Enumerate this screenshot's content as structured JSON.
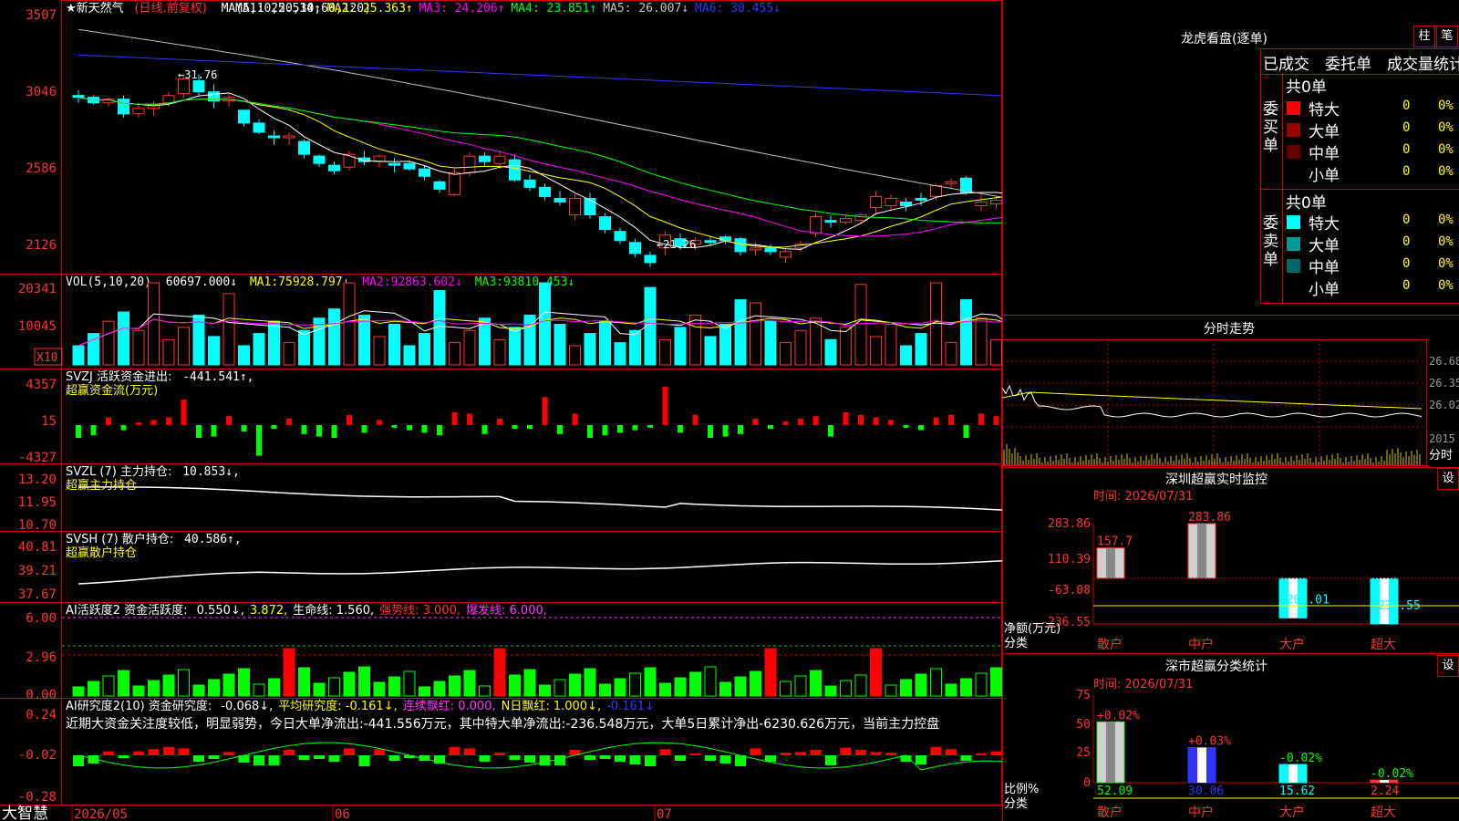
{
  "app": {
    "brand": "大智慧"
  },
  "stock": {
    "name": "★新天然气",
    "mode": "(日线,前复权)",
    "ma_label": "MA(5,10,20,30,60,120)",
    "ma_values": [
      {
        "label": "MA1:",
        "value": "25.514↑",
        "color": "#ffffff"
      },
      {
        "label": "MA2:",
        "value": "25.363↑",
        "color": "#ffff00"
      },
      {
        "label": "MA3:",
        "value": "24.206↑",
        "color": "#ff00ff"
      },
      {
        "label": "MA4:",
        "value": "23.851↑",
        "color": "#00ff00"
      },
      {
        "label": "MA5:",
        "value": "26.007↓",
        "color": "#c0c0c0"
      },
      {
        "label": "MA6:",
        "value": "30.455↓",
        "color": "#3333ff"
      }
    ],
    "high_label": "←31.76",
    "low_label": "←21.26"
  },
  "price_axis": [
    "3507",
    "3046",
    "2586",
    "2126"
  ],
  "date_axis": [
    "2026/05",
    "06",
    "07"
  ],
  "panels": {
    "vol": {
      "title": "VOL(5,10,20)",
      "value": "60697.000↓",
      "items": [
        {
          "label": "MA1:",
          "value": "75928.797↓",
          "color": "#ffff00"
        },
        {
          "label": "MA2:",
          "value": "92863.602↓",
          "color": "#ff00ff"
        },
        {
          "label": "MA3:",
          "value": "93810.453↓",
          "color": "#00ff00"
        }
      ],
      "axis": [
        "20341",
        "10045"
      ],
      "unit": "X10"
    },
    "svzj": {
      "title": "SVZJ  活跃资金进出:",
      "value": "-441.541↑,",
      "sub": "超赢资金流(万元)",
      "axis": [
        "4357",
        "15",
        "-4327"
      ]
    },
    "svzl": {
      "title": "SVZL (7) 主力持仓:",
      "value": "10.853↓,",
      "sub": "超赢主力持仓",
      "axis": [
        "13.20",
        "11.95",
        "10.70"
      ]
    },
    "svsh": {
      "title": "SVSH (7) 散户持仓:",
      "value": "40.586↑,",
      "sub": "超赢散户持仓",
      "axis": [
        "40.81",
        "39.21",
        "37.67"
      ]
    },
    "ai1": {
      "title": "AI活跃度2 资金活跃度:",
      "items": [
        {
          "text": "0.550↓,",
          "color": "#ffffff"
        },
        {
          "text": "3.872,",
          "color": "#ffff00"
        },
        {
          "text": "生命线: 1.560,",
          "color": "#ffffff"
        },
        {
          "text": "强势线: 3.000,",
          "color": "#ff3333"
        },
        {
          "text": "爆发线: 6.000,",
          "color": "#ff33ff"
        }
      ],
      "axis": [
        "6.00",
        "2.96",
        "0.00"
      ]
    },
    "ai2": {
      "title": "AI研究度2(10) 资金研究度:",
      "items": [
        {
          "text": "-0.068↓,",
          "color": "#ffffff"
        },
        {
          "text": "平均研究度: -0.161↓,",
          "color": "#ffff00"
        },
        {
          "text": "连续飘红: 0.000,",
          "color": "#ff33ff"
        },
        {
          "text": "N日飘红: 1.000↓,",
          "color": "#ffff00"
        },
        {
          "text": "-0.161↓",
          "color": "#3333ff"
        }
      ],
      "comment": "近期大资金关注度较低，明显弱势，今日大单净流出:-441.556万元，其中特大单净流出:-236.548万元，大单5日累计净出-6230.626万元，当前主力控盘",
      "axis": [
        "0.24",
        "-0.02",
        "-0.28"
      ]
    }
  },
  "lhb": {
    "title": "龙虎看盘(逐单)",
    "btn_zhu": "柱",
    "btn_bi": "笔",
    "tabs": [
      "已成交",
      "委托单",
      "成交量统计"
    ],
    "buy": {
      "side": "委买单",
      "total": "共0单",
      "rows": [
        {
          "label": "特大",
          "count": "0",
          "pct": "0%",
          "color": "#ff0000"
        },
        {
          "label": "大单",
          "count": "0",
          "pct": "0%",
          "color": "#990000"
        },
        {
          "label": "中单",
          "count": "0",
          "pct": "0%",
          "color": "#660000"
        },
        {
          "label": "小单",
          "count": "0",
          "pct": "0%",
          "color": "#000000"
        }
      ]
    },
    "sell": {
      "side": "委卖单",
      "total": "共0单",
      "rows": [
        {
          "label": "特大",
          "count": "0",
          "pct": "0%",
          "color": "#00ffff"
        },
        {
          "label": "大单",
          "count": "0",
          "pct": "0%",
          "color": "#009999"
        },
        {
          "label": "中单",
          "count": "0",
          "pct": "0%",
          "color": "#006666"
        },
        {
          "label": "小单",
          "count": "0",
          "pct": "0%",
          "color": "#000000"
        }
      ]
    }
  },
  "fenshi": {
    "title": "分时走势",
    "axis": [
      "26.68",
      "26.35",
      "26.02",
      "2015",
      "分时"
    ]
  },
  "monitor": {
    "title": "深圳超赢实时监控",
    "set": "设",
    "time": "时间: 2026/07/31",
    "axis": [
      "283.86",
      "110.39",
      "-63.08",
      "-236.55"
    ],
    "ylabel": "净额(万元)",
    "xlabel": "分类",
    "categories": [
      "散户",
      "中户",
      "大户",
      "超大"
    ],
    "values": [
      157.7,
      283.86,
      -205.01,
      -236.55
    ],
    "value_labels": [
      "157.7",
      "283.86",
      "-205.01",
      "-236.55"
    ]
  },
  "classify": {
    "title": "深市超赢分类统计",
    "set": "设",
    "time": "时间: 2026/07/31",
    "axis": [
      "75",
      "50",
      "25",
      "0"
    ],
    "ylabel": "比例%",
    "xlabel": "分类",
    "categories": [
      "散户",
      "中户",
      "大户",
      "超大"
    ],
    "values": [
      52.09,
      30.06,
      15.62,
      2.24
    ],
    "value_labels": [
      "52.09",
      "30.06",
      "15.62",
      "2.24"
    ],
    "change_labels": [
      "+0.02%",
      "+0.03%",
      "-0.02%",
      "-0.02%"
    ]
  },
  "chart_data": [
    {
      "type": "candlestick",
      "title": "新天然气 (日线,前复权)",
      "x_ticks": [
        "2026/05",
        "06",
        "07"
      ],
      "ylim": [
        21.0,
        35.5
      ],
      "candles": [
        [
          30.6,
          30.9,
          30.2,
          30.5
        ],
        [
          30.5,
          30.6,
          30.1,
          30.2
        ],
        [
          30.2,
          30.5,
          30.0,
          30.4
        ],
        [
          30.4,
          30.6,
          29.4,
          29.6
        ],
        [
          29.6,
          30.2,
          29.4,
          29.9
        ],
        [
          29.9,
          30.3,
          29.5,
          30.1
        ],
        [
          30.2,
          30.8,
          30.0,
          30.6
        ],
        [
          30.7,
          31.6,
          30.5,
          31.5
        ],
        [
          31.4,
          31.76,
          30.6,
          30.8
        ],
        [
          30.8,
          31.2,
          29.9,
          30.3
        ],
        [
          30.3,
          30.7,
          30.0,
          30.5
        ],
        [
          29.8,
          29.8,
          28.9,
          29.1
        ],
        [
          29.1,
          29.3,
          28.5,
          28.6
        ],
        [
          28.4,
          28.7,
          27.9,
          28.3
        ],
        [
          28.3,
          28.6,
          27.9,
          28.4
        ],
        [
          28.1,
          28.2,
          27.2,
          27.4
        ],
        [
          27.3,
          27.4,
          26.7,
          26.9
        ],
        [
          26.8,
          27.0,
          26.3,
          26.5
        ],
        [
          26.7,
          27.6,
          26.5,
          27.4
        ],
        [
          27.2,
          27.6,
          26.8,
          27.0
        ],
        [
          27.0,
          27.4,
          26.7,
          27.3
        ],
        [
          26.9,
          27.2,
          26.4,
          26.8
        ],
        [
          26.9,
          27.0,
          26.5,
          26.6
        ],
        [
          26.6,
          26.8,
          26.0,
          26.2
        ],
        [
          25.9,
          26.0,
          25.3,
          25.5
        ],
        [
          25.2,
          26.6,
          25.1,
          26.4
        ],
        [
          26.4,
          27.5,
          26.2,
          27.3
        ],
        [
          27.3,
          27.5,
          26.8,
          27.0
        ],
        [
          26.9,
          27.6,
          26.6,
          27.3
        ],
        [
          27.1,
          27.4,
          25.9,
          26.0
        ],
        [
          26.0,
          26.3,
          25.4,
          25.6
        ],
        [
          25.6,
          25.8,
          24.9,
          25.1
        ],
        [
          25.0,
          25.4,
          24.6,
          24.8
        ],
        [
          24.1,
          25.2,
          23.8,
          25.0
        ],
        [
          25.0,
          25.3,
          23.9,
          24.1
        ],
        [
          24.0,
          24.2,
          23.1,
          23.3
        ],
        [
          23.2,
          23.4,
          22.5,
          22.7
        ],
        [
          22.6,
          22.8,
          21.8,
          22.0
        ],
        [
          21.9,
          22.1,
          21.26,
          21.5
        ],
        [
          22.3,
          23.2,
          21.9,
          23.0
        ],
        [
          22.8,
          23.1,
          22.2,
          22.4
        ],
        [
          22.5,
          22.9,
          22.2,
          22.7
        ],
        [
          22.7,
          22.9,
          22.4,
          22.6
        ],
        [
          22.9,
          23.0,
          22.5,
          22.7
        ],
        [
          22.8,
          22.9,
          21.9,
          22.1
        ],
        [
          22.2,
          22.6,
          21.9,
          22.3
        ],
        [
          22.3,
          22.5,
          21.9,
          22.1
        ],
        [
          21.8,
          22.3,
          21.5,
          22.1
        ],
        [
          22.3,
          22.7,
          22.1,
          22.5
        ],
        [
          23.1,
          24.2,
          22.9,
          24.0
        ],
        [
          23.8,
          24.1,
          23.4,
          23.7
        ],
        [
          23.7,
          24.1,
          23.6,
          23.9
        ],
        [
          23.8,
          24.2,
          23.6,
          24.1
        ],
        [
          24.5,
          25.4,
          24.1,
          25.1
        ],
        [
          24.6,
          25.2,
          24.3,
          25.0
        ],
        [
          24.8,
          25.0,
          24.3,
          24.6
        ],
        [
          25.0,
          25.3,
          24.6,
          24.9
        ],
        [
          25.1,
          25.8,
          24.9,
          25.7
        ],
        [
          25.8,
          26.1,
          25.5,
          25.9
        ],
        [
          26.1,
          26.2,
          25.2,
          25.3
        ],
        [
          24.6,
          25.2,
          24.3,
          24.8
        ],
        [
          24.7,
          25.1,
          24.4,
          24.9
        ],
        [
          24.8,
          25.5,
          24.6,
          25.3
        ],
        [
          25.2,
          26.3,
          25.0,
          26.2
        ],
        [
          26.1,
          26.6,
          25.8,
          26.3
        ],
        [
          25.9,
          26.2,
          25.6,
          25.7
        ]
      ]
    },
    {
      "type": "bar",
      "title": "深圳超赢实时监控",
      "ylabel": "净额(万元)",
      "xlabel": "分类",
      "categories": [
        "散户",
        "中户",
        "大户",
        "超大"
      ],
      "values": [
        157.7,
        283.86,
        -205.01,
        -236.55
      ],
      "ylim": [
        -236.55,
        283.86
      ]
    },
    {
      "type": "bar",
      "title": "深市超赢分类统计",
      "ylabel": "比例%",
      "xlabel": "分类",
      "categories": [
        "散户",
        "中户",
        "大户",
        "超大"
      ],
      "values": [
        52.09,
        30.06,
        15.62,
        2.24
      ],
      "ylim": [
        0,
        75
      ]
    }
  ]
}
